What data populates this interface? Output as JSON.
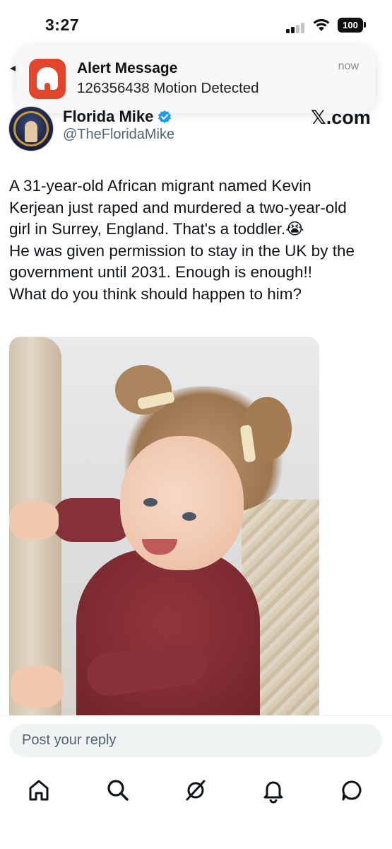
{
  "status_bar": {
    "time": "3:27",
    "battery": "100"
  },
  "notification": {
    "app_icon": "alert-app-icon",
    "title": "Alert Message",
    "body": "126356438 Motion Detected",
    "time": "now"
  },
  "post": {
    "author": {
      "name": "Florida Mike",
      "handle": "@TheFloridaMike",
      "verified": true
    },
    "source_label": "𝕏.com",
    "text_lines": [
      "A 31-year-old African migrant named Kevin",
      "Kerjean just raped and murdered a two-year-old",
      "girl in Surrey, England. That's a toddler.😭",
      "He was given permission to stay in the UK by the",
      "government until 2031. Enough is enough!!",
      "What do you think should happen to him?"
    ],
    "image": "photo-toddler-red-outfit"
  },
  "reply": {
    "placeholder": "Post your reply"
  },
  "tab_bar": {
    "items": [
      "home-icon",
      "search-icon",
      "grok-icon",
      "notifications-icon",
      "messages-icon"
    ]
  },
  "colors": {
    "text": "#0f1419",
    "secondary": "#536471",
    "verified": "#1d9bf0",
    "alert_icon": "#e3452c",
    "reply_bg": "#eff3f4"
  }
}
